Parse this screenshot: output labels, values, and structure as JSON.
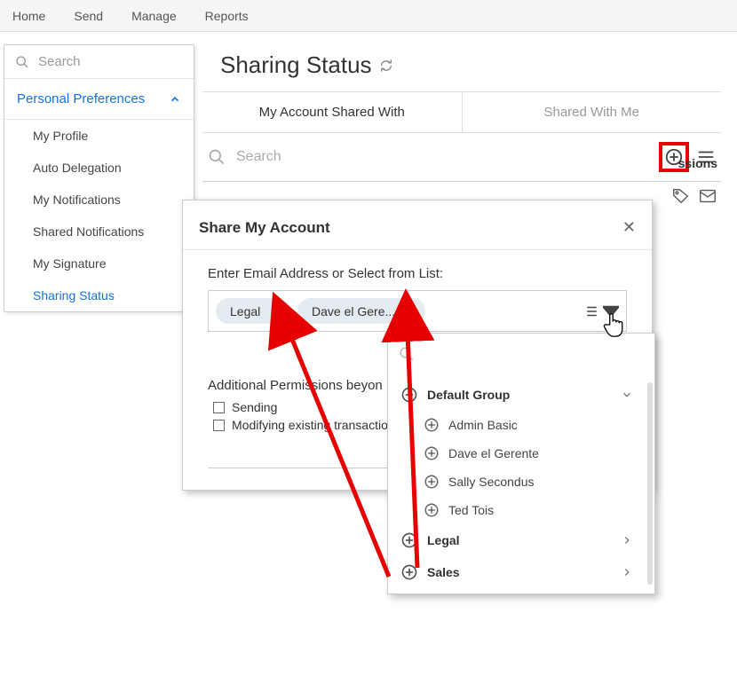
{
  "topnav": [
    "Home",
    "Send",
    "Manage",
    "Reports"
  ],
  "sidebar": {
    "search_placeholder": "Search",
    "section": "Personal Preferences",
    "items": [
      "My Profile",
      "Auto Delegation",
      "My Notifications",
      "Shared Notifications",
      "My Signature",
      "Sharing Status"
    ],
    "active_index": 5
  },
  "page": {
    "title": "Sharing Status",
    "tabs": [
      "My Account Shared With",
      "Shared With Me"
    ],
    "active_tab": 0,
    "search_placeholder": "Search",
    "perm_header_fragment": "ssions"
  },
  "modal": {
    "title": "Share My Account",
    "field_label": "Enter Email Address or Select from List:",
    "chips": [
      "Legal",
      "Dave el Gere..."
    ],
    "perm_label": "Additional Permissions beyon",
    "checkboxes": [
      "Sending",
      "Modifying existing transactio"
    ]
  },
  "dropdown": {
    "groups": [
      {
        "name": "Default Group",
        "expanded": true,
        "items": [
          "Admin Basic",
          "Dave el Gerente",
          "Sally Secondus",
          "Ted Tois"
        ]
      },
      {
        "name": "Legal",
        "expanded": false,
        "items": []
      },
      {
        "name": "Sales",
        "expanded": false,
        "items": []
      }
    ]
  }
}
